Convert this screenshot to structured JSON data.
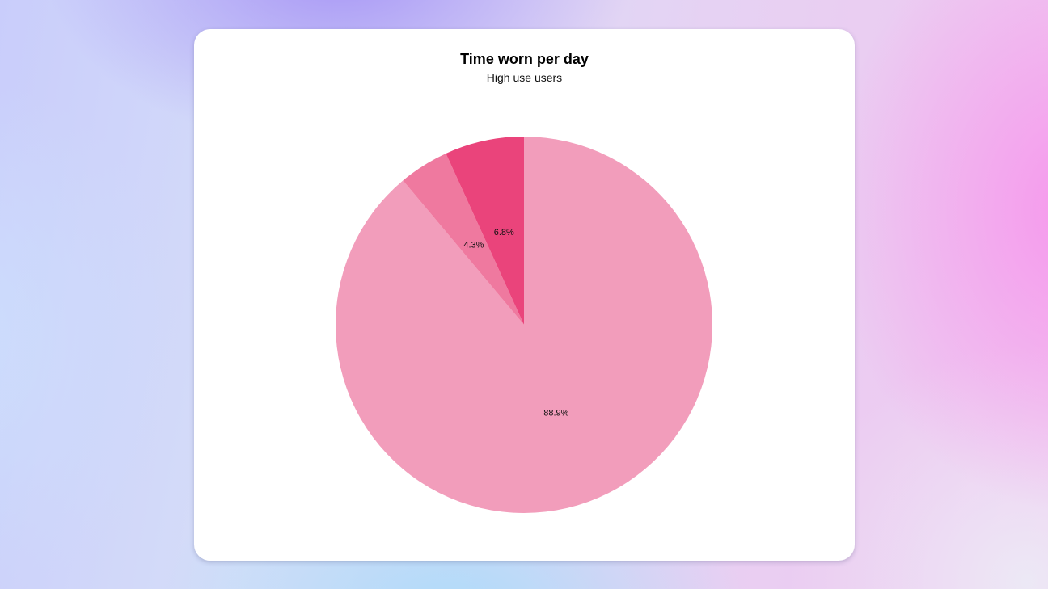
{
  "chart_data": {
    "type": "pie",
    "title": "Time worn per day",
    "subtitle": "High use users",
    "start": "top",
    "direction": "clockwise",
    "slices": [
      {
        "value": 88.9,
        "label": "88.9%",
        "color": "#f29dbb"
      },
      {
        "value": 4.3,
        "label": "4.3%",
        "color": "#ef799f"
      },
      {
        "value": 6.8,
        "label": "6.8%",
        "color": "#ea447b"
      }
    ]
  }
}
